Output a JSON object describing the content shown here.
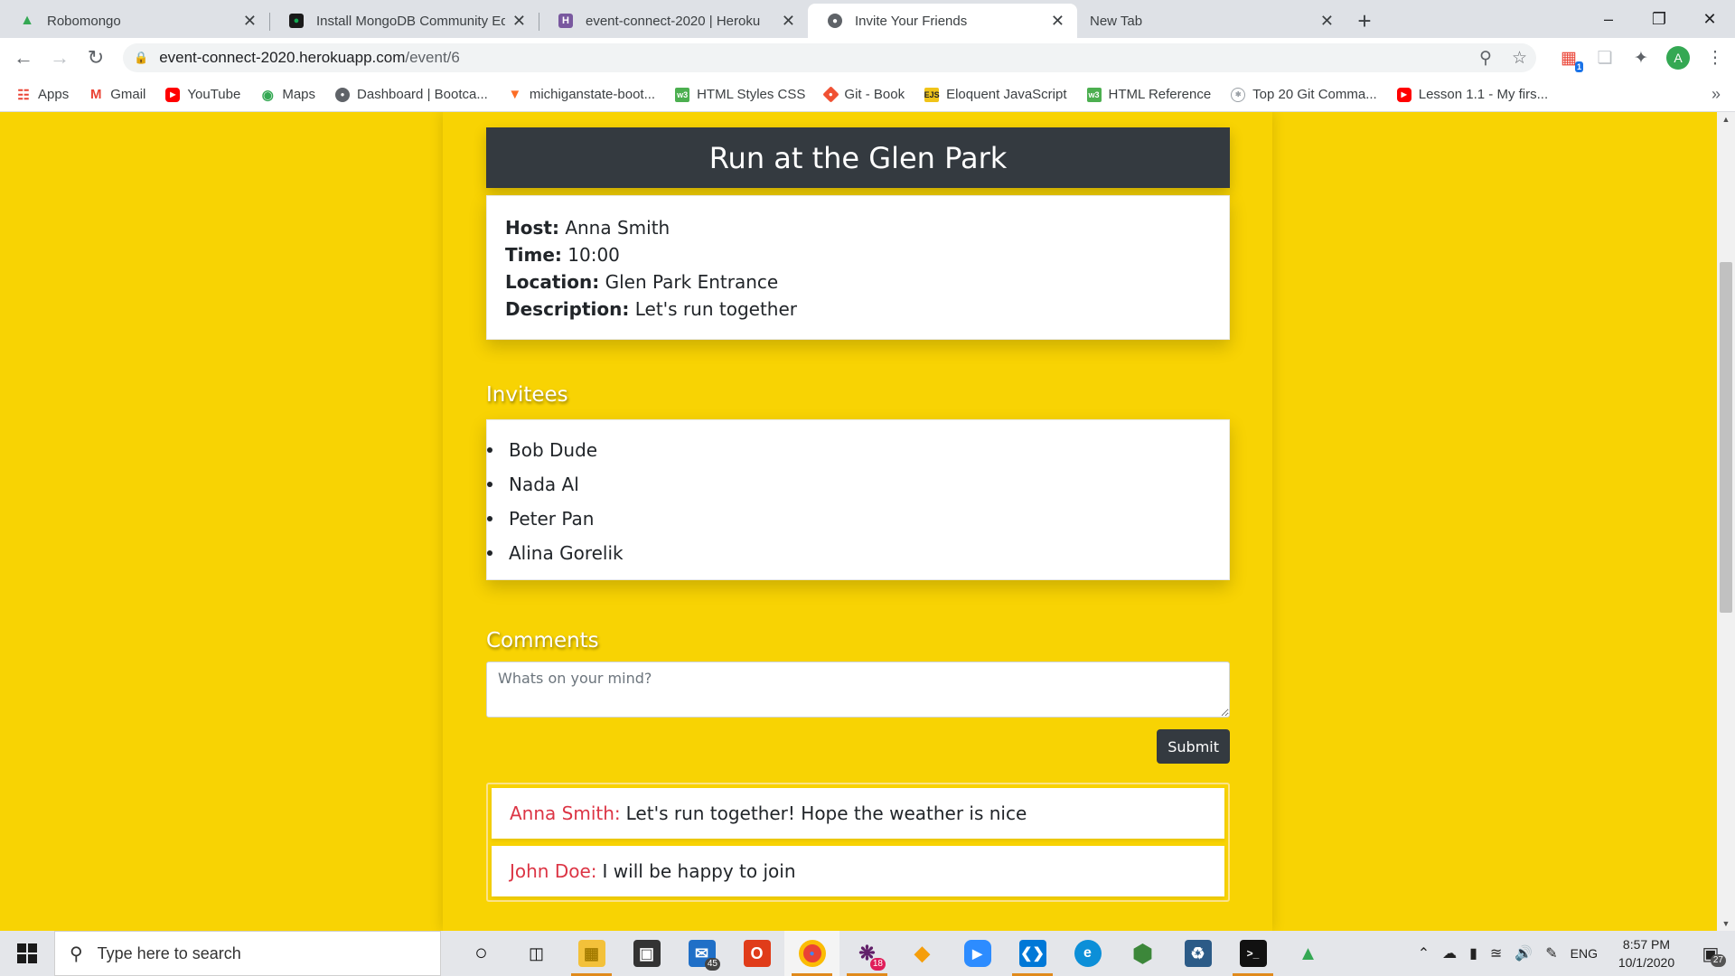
{
  "browser": {
    "tabs": [
      {
        "title": "Robomongo",
        "icon": "robomongo-icon",
        "color": "#34a853"
      },
      {
        "title": "Install MongoDB Community Edition",
        "icon": "mongodb-icon",
        "color": "#13aa52"
      },
      {
        "title": "event-connect-2020 | Heroku",
        "icon": "heroku-icon",
        "color": "#79589f"
      },
      {
        "title": "Invite Your Friends",
        "icon": "globe-icon",
        "color": "#5f6368",
        "active": true
      },
      {
        "title": "New Tab",
        "icon": "",
        "color": ""
      }
    ],
    "url_host": "event-connect-2020.herokuapp.com",
    "url_path": "/event/6",
    "profile_initial": "A",
    "extension_badge": "1",
    "bookmarks": [
      {
        "label": "Apps",
        "icon": "apps-grid-icon"
      },
      {
        "label": "Gmail",
        "icon": "gmail-icon"
      },
      {
        "label": "YouTube",
        "icon": "youtube-icon"
      },
      {
        "label": "Maps",
        "icon": "maps-icon"
      },
      {
        "label": "Dashboard | Bootca...",
        "icon": "globe-icon"
      },
      {
        "label": "michiganstate-boot...",
        "icon": "gitlab-icon"
      },
      {
        "label": "HTML Styles CSS",
        "icon": "w3schools-icon"
      },
      {
        "label": "Git - Book",
        "icon": "git-icon"
      },
      {
        "label": "Eloquent JavaScript",
        "icon": "ejs-icon"
      },
      {
        "label": "HTML Reference",
        "icon": "w3schools-icon"
      },
      {
        "label": "Top 20 Git Comma...",
        "icon": "globe-icon"
      },
      {
        "label": "Lesson 1.1 - My firs...",
        "icon": "youtube-icon"
      }
    ]
  },
  "event": {
    "title": "Run at the Glen Park",
    "host_label": "Host:",
    "host": "Anna Smith",
    "time_label": "Time:",
    "time": "10:00",
    "location_label": "Location:",
    "location": "Glen Park Entrance",
    "description_label": "Description:",
    "description": "Let's run together"
  },
  "invitees": {
    "heading": "Invitees",
    "list": [
      "Bob Dude",
      "Nada Al",
      "Peter Pan",
      "Alina Gorelik"
    ]
  },
  "comments": {
    "heading": "Comments",
    "placeholder": "Whats on your mind?",
    "submit_label": "Submit",
    "items": [
      {
        "author": "Anna Smith:",
        "text": "Let's run together! Hope the weather is nice"
      },
      {
        "author": "John Doe:",
        "text": "I will be happy to join"
      }
    ]
  },
  "taskbar": {
    "search_placeholder": "Type here to search",
    "mail_badge": "45",
    "slack_badge": "18",
    "language": "ENG",
    "time": "8:57 PM",
    "date": "10/1/2020",
    "notification_count": "27"
  },
  "colors": {
    "page_background": "#f8d303",
    "title_bar": "#343a40",
    "author_red": "#dc3545"
  }
}
